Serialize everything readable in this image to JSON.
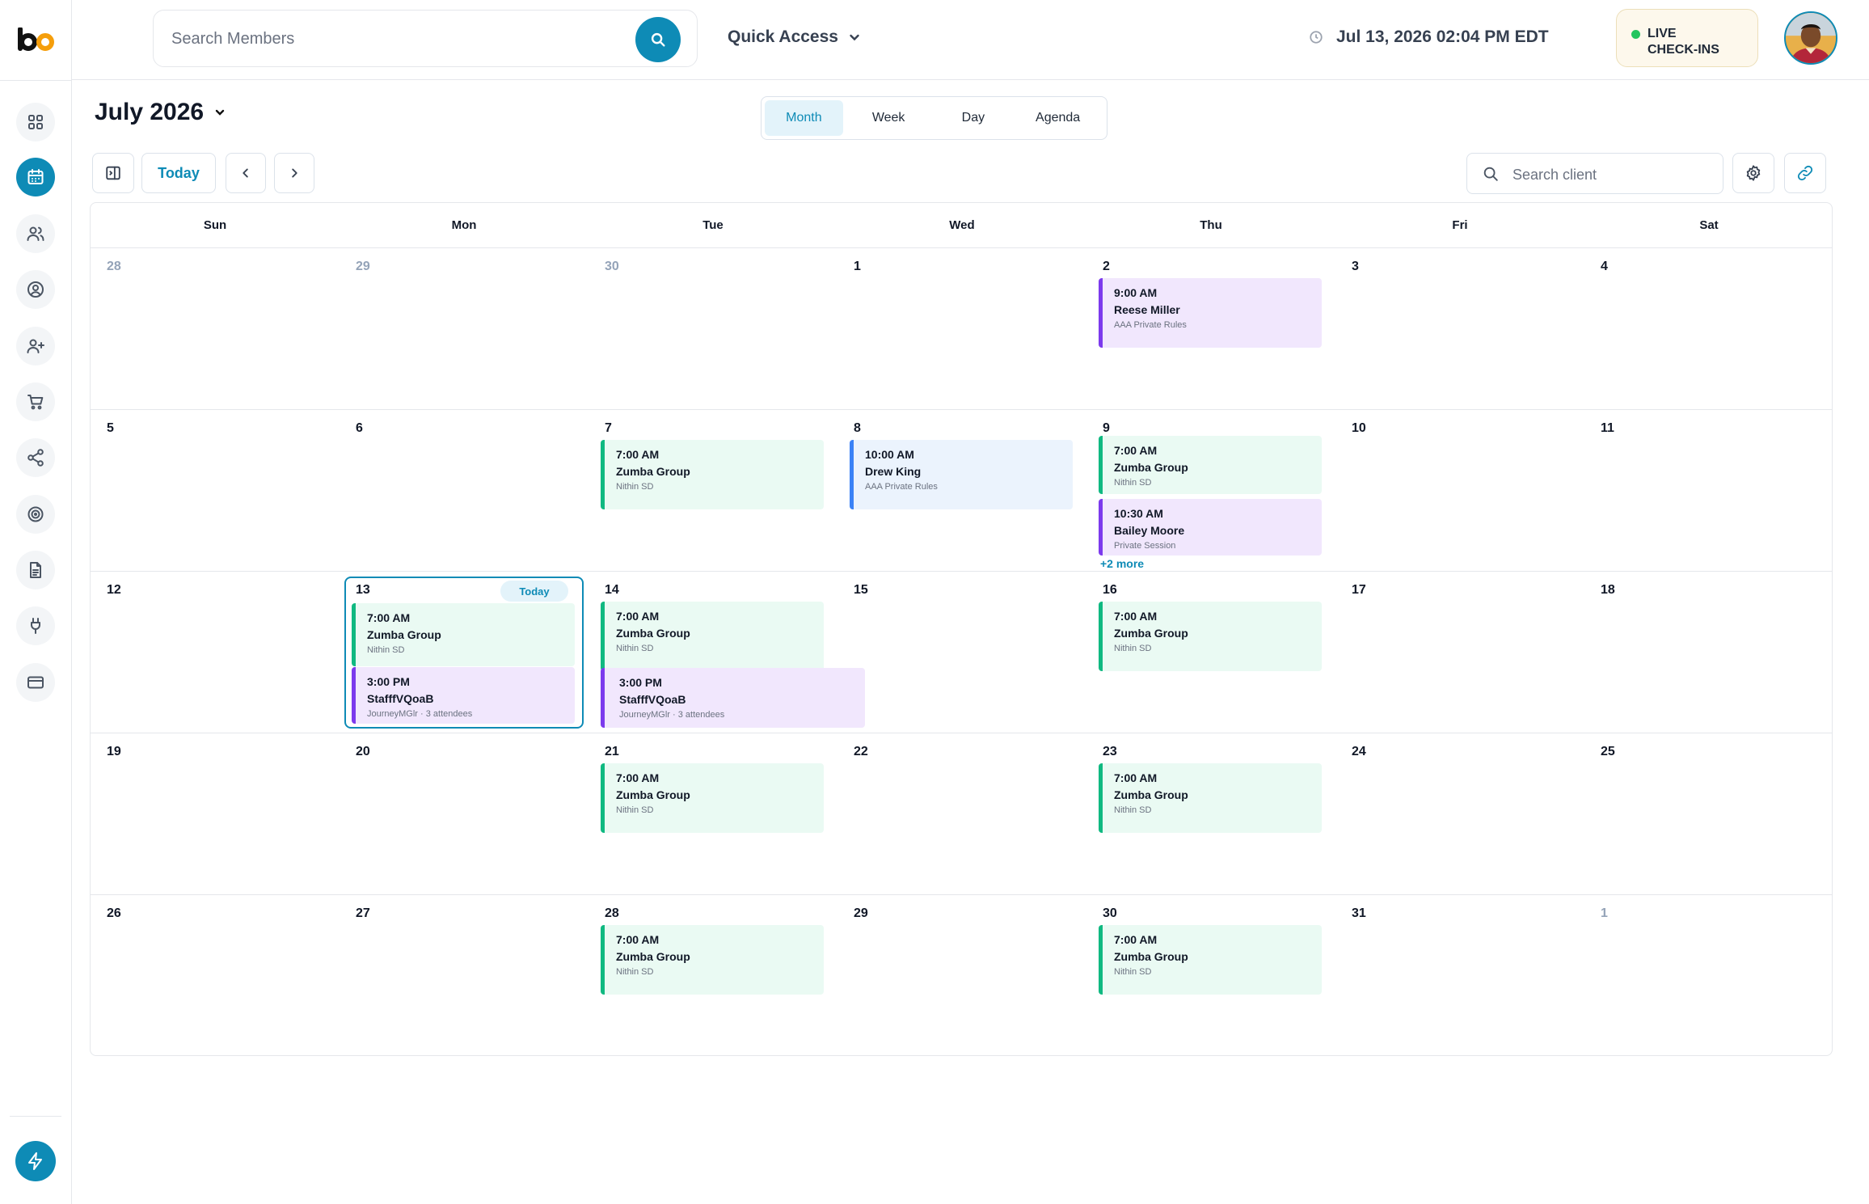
{
  "header": {
    "search_placeholder": "Search Members",
    "quick_access": "Quick Access",
    "datetime": "Jul 13, 2026  02:04 PM EDT",
    "live_line1": "LIVE",
    "live_line2": "CHECK-INS"
  },
  "sidebar": {
    "items": [
      "dashboard-icon",
      "calendar-icon",
      "members-icon",
      "profile-icon",
      "add-user-icon",
      "cart-icon",
      "share-icon",
      "target-icon",
      "document-icon",
      "plug-icon",
      "card-icon"
    ],
    "active": "calendar-icon"
  },
  "toolbar": {
    "month_title": "July 2026",
    "views": [
      "Month",
      "Week",
      "Day",
      "Agenda"
    ],
    "active_view": "Month",
    "today_label": "Today",
    "client_search_placeholder": "Search client"
  },
  "calendar": {
    "weekdays": [
      "Sun",
      "Mon",
      "Tue",
      "Wed",
      "Thu",
      "Fri",
      "Sat"
    ],
    "weeks": [
      [
        "28",
        "29",
        "30",
        "1",
        "2",
        "3",
        "4"
      ],
      [
        "5",
        "6",
        "7",
        "8",
        "9",
        "10",
        "11"
      ],
      [
        "12",
        "13",
        "14",
        "15",
        "16",
        "17",
        "18"
      ],
      [
        "19",
        "20",
        "21",
        "22",
        "23",
        "24",
        "25"
      ],
      [
        "26",
        "27",
        "28",
        "29",
        "30",
        "31",
        "1"
      ]
    ],
    "today_pill": "Today",
    "more_label": "+2 more",
    "events": {
      "w0_thu": {
        "time": "9:00 AM",
        "title": "Reese Miller",
        "sub": "AAA Private Rules"
      },
      "w1_tue": {
        "time": "7:00 AM",
        "title": "Zumba Group",
        "sub": "Nithin SD"
      },
      "w1_wed": {
        "time": "10:00 AM",
        "title": "Drew King",
        "sub": "AAA Private Rules"
      },
      "w1_thu_a": {
        "time": "7:00 AM",
        "title": "Zumba Group",
        "sub": "Nithin SD"
      },
      "w1_thu_b": {
        "time": "10:30 AM",
        "title": "Bailey Moore",
        "sub": "Private Session"
      },
      "w2_mon_a": {
        "time": "7:00 AM",
        "title": "Zumba Group",
        "sub": "Nithin SD"
      },
      "w2_mon_b": {
        "time": "3:00 PM",
        "title": "StafffVQoaB",
        "sub": "JourneyMGlr · 3 attendees"
      },
      "w2_tue_a": {
        "time": "7:00 AM",
        "title": "Zumba Group",
        "sub": "Nithin SD"
      },
      "w2_tue_b": {
        "time": "3:00 PM",
        "title": "StafffVQoaB",
        "sub": "JourneyMGlr · 3 attendees"
      },
      "w2_thu": {
        "time": "7:00 AM",
        "title": "Zumba Group",
        "sub": "Nithin SD"
      },
      "w3_tue": {
        "time": "7:00 AM",
        "title": "Zumba Group",
        "sub": "Nithin SD"
      },
      "w3_thu": {
        "time": "7:00 AM",
        "title": "Zumba Group",
        "sub": "Nithin SD"
      },
      "w4_tue": {
        "time": "7:00 AM",
        "title": "Zumba Group",
        "sub": "Nithin SD"
      },
      "w4_thu": {
        "time": "7:00 AM",
        "title": "Zumba Group",
        "sub": "Nithin SD"
      }
    }
  },
  "colors": {
    "accent": "#0e8bb6",
    "green": "#10b981",
    "purple": "#7c3aed",
    "blue": "#3b82f6"
  }
}
